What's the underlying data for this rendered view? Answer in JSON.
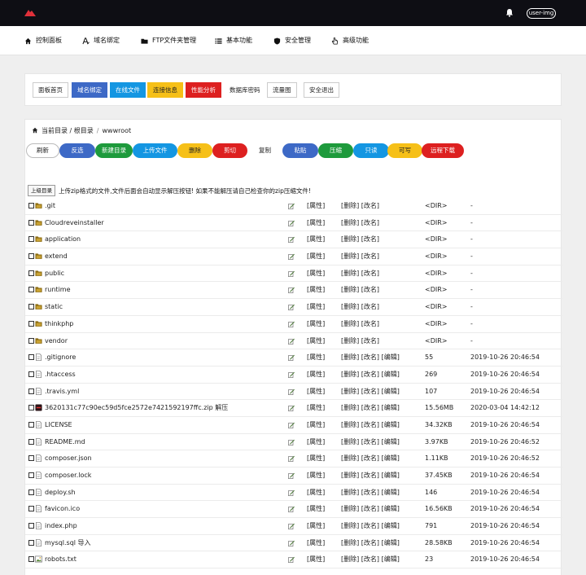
{
  "topbar": {
    "user_image_alt": "user-img"
  },
  "nav": [
    {
      "label": "控制面板",
      "icon": "home-icon"
    },
    {
      "label": "域名绑定",
      "icon": "text-icon"
    },
    {
      "label": "FTP文件夹管理",
      "icon": "folder-icon"
    },
    {
      "label": "基本功能",
      "icon": "list-icon"
    },
    {
      "label": "安全管理",
      "icon": "shield-icon"
    },
    {
      "label": "高级功能",
      "icon": "hand-pointer-icon"
    }
  ],
  "toolbar": [
    {
      "label": "面板首页",
      "style": "default"
    },
    {
      "label": "域名绑定",
      "style": "blue"
    },
    {
      "label": "在线文件",
      "style": "sky"
    },
    {
      "label": "连接信息",
      "style": "yellow"
    },
    {
      "label": "性能分析",
      "style": "red"
    },
    {
      "label": "数据库密码",
      "style": "plain"
    },
    {
      "label": "流量图",
      "style": "default"
    },
    {
      "label": "安全退出",
      "style": "default"
    }
  ],
  "breadcrumb": {
    "current": "当前目录 / 根目录",
    "separator": "/",
    "folder": "wwwroot"
  },
  "actions": [
    {
      "label": "刷新",
      "style": "white"
    },
    {
      "label": "反选",
      "style": "blue"
    },
    {
      "label": "新建目录",
      "style": "green"
    },
    {
      "label": "上传文件",
      "style": "sky"
    },
    {
      "label": "删除",
      "style": "yellow"
    },
    {
      "label": "剪切",
      "style": "red"
    },
    {
      "label": "复制",
      "style": "plain"
    },
    {
      "label": "粘贴",
      "style": "blue"
    },
    {
      "label": "压缩",
      "style": "green"
    },
    {
      "label": "只读",
      "style": "sky"
    },
    {
      "label": "可写",
      "style": "yellow"
    },
    {
      "label": "远程下载",
      "style": "red"
    }
  ],
  "up_button": "上级目录",
  "notice": "上传zip格式的文件,文件后面会自动显示解压按钮! 如果不能解压请自己检查你的zip压缩文件!",
  "files": [
    {
      "name": ".git",
      "type": "dir",
      "act1": "[属性]",
      "act2": "[删除] [改名]",
      "size": "<DIR>",
      "date": "-"
    },
    {
      "name": "Cloudreveinstaller",
      "type": "dir",
      "act1": "[属性]",
      "act2": "[删除] [改名]",
      "size": "<DIR>",
      "date": "-"
    },
    {
      "name": "application",
      "type": "dir",
      "act1": "[属性]",
      "act2": "[删除] [改名]",
      "size": "<DIR>",
      "date": "-"
    },
    {
      "name": "extend",
      "type": "dir",
      "act1": "[属性]",
      "act2": "[删除] [改名]",
      "size": "<DIR>",
      "date": "-"
    },
    {
      "name": "public",
      "type": "dir",
      "act1": "[属性]",
      "act2": "[删除] [改名]",
      "size": "<DIR>",
      "date": "-"
    },
    {
      "name": "runtime",
      "type": "dir",
      "act1": "[属性]",
      "act2": "[删除] [改名]",
      "size": "<DIR>",
      "date": "-"
    },
    {
      "name": "static",
      "type": "dir",
      "act1": "[属性]",
      "act2": "[删除] [改名]",
      "size": "<DIR>",
      "date": "-"
    },
    {
      "name": "thinkphp",
      "type": "dir",
      "act1": "[属性]",
      "act2": "[删除] [改名]",
      "size": "<DIR>",
      "date": "-"
    },
    {
      "name": "vendor",
      "type": "dir",
      "act1": "[属性]",
      "act2": "[删除] [改名]",
      "size": "<DIR>",
      "date": "-"
    },
    {
      "name": ".gitignore",
      "type": "file",
      "act1": "[属性]",
      "act2": "[删除] [改名] [编辑]",
      "size": "55",
      "date": "2019-10-26 20:46:54"
    },
    {
      "name": ".htaccess",
      "type": "file",
      "act1": "[属性]",
      "act2": "[删除] [改名] [编辑]",
      "size": "269",
      "date": "2019-10-26 20:46:54"
    },
    {
      "name": ".travis.yml",
      "type": "file",
      "act1": "[属性]",
      "act2": "[删除] [改名] [编辑]",
      "size": "107",
      "date": "2019-10-26 20:46:54"
    },
    {
      "name": "3620131c77c90ec59d5fce2572e7421592197ffc.zip 解压",
      "type": "zip",
      "act1": "[属性]",
      "act2": "[删除] [改名] [编辑]",
      "size": "15.56MB",
      "date": "2020-03-04 14:42:12"
    },
    {
      "name": "LICENSE",
      "type": "file",
      "act1": "[属性]",
      "act2": "[删除] [改名] [编辑]",
      "size": "34.32KB",
      "date": "2019-10-26 20:46:54"
    },
    {
      "name": "README.md",
      "type": "file",
      "act1": "[属性]",
      "act2": "[删除] [改名] [编辑]",
      "size": "3.97KB",
      "date": "2019-10-26 20:46:52"
    },
    {
      "name": "composer.json",
      "type": "file",
      "act1": "[属性]",
      "act2": "[删除] [改名] [编辑]",
      "size": "1.11KB",
      "date": "2019-10-26 20:46:52"
    },
    {
      "name": "composer.lock",
      "type": "file",
      "act1": "[属性]",
      "act2": "[删除] [改名] [编辑]",
      "size": "37.45KB",
      "date": "2019-10-26 20:46:54"
    },
    {
      "name": "deploy.sh",
      "type": "file",
      "act1": "[属性]",
      "act2": "[删除] [改名] [编辑]",
      "size": "146",
      "date": "2019-10-26 20:46:54"
    },
    {
      "name": "favicon.ico",
      "type": "file",
      "act1": "[属性]",
      "act2": "[删除] [改名] [编辑]",
      "size": "16.56KB",
      "date": "2019-10-26 20:46:54"
    },
    {
      "name": "index.php",
      "type": "file",
      "act1": "[属性]",
      "act2": "[删除] [改名] [编辑]",
      "size": "791",
      "date": "2019-10-26 20:46:54"
    },
    {
      "name": "mysql.sql 导入",
      "type": "file",
      "act1": "[属性]",
      "act2": "[删除] [改名] [编辑]",
      "size": "28.58KB",
      "date": "2019-10-26 20:46:54"
    },
    {
      "name": "robots.txt",
      "type": "image",
      "act1": "[属性]",
      "act2": "[删除] [改名] [编辑]",
      "size": "23",
      "date": "2019-10-26 20:46:54"
    }
  ],
  "colors": {
    "topbar": "#0e0e14",
    "blue": "#3d69c6",
    "sky": "#1496e2",
    "green": "#1e9a3c",
    "yellow": "#f6c018",
    "red": "#dd2020",
    "logo": "#e0303a"
  }
}
